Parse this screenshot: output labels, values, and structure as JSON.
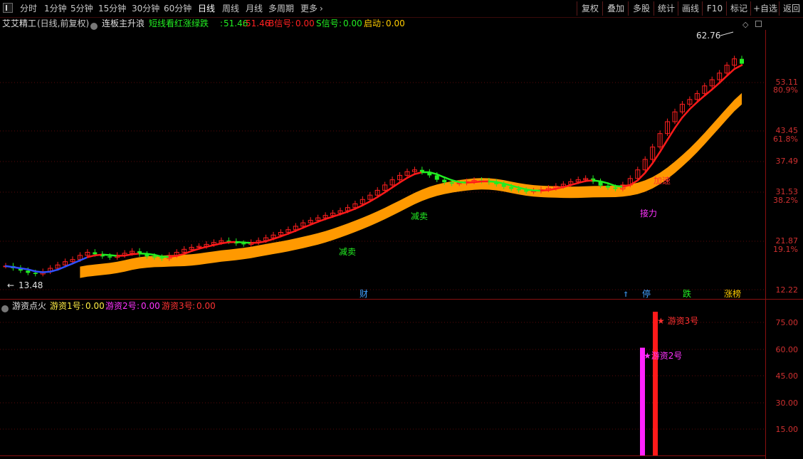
{
  "toolbar": {
    "period_tabs": [
      "分时",
      "1分钟",
      "5分钟",
      "15分钟",
      "30分钟",
      "60分钟",
      "日线",
      "周线",
      "月线",
      "多周期",
      "更多"
    ],
    "active_tab": "日线",
    "right_buttons": [
      "复权",
      "叠加",
      "多股",
      "统计",
      "画线",
      "F10",
      "标记",
      "+自选",
      "返回"
    ]
  },
  "main_header": {
    "stock_name": "艾艾精工",
    "mode": "(日线,前复权)",
    "indicator_name": "连板主升浪",
    "line_label": "短线看红涨绿跌",
    "line_value_1": "51.46",
    "line_value_2": "51.46",
    "b_signal_label": "B信号",
    "b_signal_value": "0.00",
    "s_signal_label": "S信号",
    "s_signal_value": "0.00",
    "start_label": "启动",
    "start_value": "0.00"
  },
  "price_axis": {
    "ticks": [
      "53.11",
      "43.45",
      "37.49",
      "31.53",
      "21.87",
      "12.22"
    ],
    "percent_ticks": [
      "80.9%",
      "61.8%",
      "38.2%",
      "19.1%"
    ]
  },
  "main_annotations": {
    "max_price": "62.76",
    "min_price": "13.48",
    "reduce_1": "减卖",
    "reduce_2": "减卖",
    "accelerate": "加速",
    "relay": "接力",
    "marker_cai": "财",
    "marker_ting": "停",
    "marker_die": "跌",
    "marker_zhangbang": "涨榜"
  },
  "sub_header": {
    "indicator_name": "游资点火",
    "y1_label": "游资1号",
    "y1_value": "0.00",
    "y2_label": "游资2号",
    "y2_value": "0.00",
    "y3_label": "游资3号",
    "y3_value": "0.00"
  },
  "sub_axis": {
    "ticks": [
      "75.00",
      "60.00",
      "45.00",
      "30.00",
      "15.00"
    ]
  },
  "sub_annotations": {
    "bar2_label": "★游资2号",
    "bar3_label": "★ 游资3号"
  },
  "chart_data": [
    {
      "type": "candlestick",
      "title": "艾艾精工 (日线,前复权)",
      "ylim": [
        12.22,
        63
      ],
      "series": [
        {
          "name": "短线看红涨绿跌",
          "color": "#ff2020",
          "last_value": 51.46
        },
        {
          "name": "band",
          "color": "#ff9900"
        }
      ],
      "candles_close_approx": [
        14.2,
        14.0,
        13.8,
        13.6,
        13.5,
        13.7,
        14.0,
        14.3,
        14.6,
        14.8,
        15.2,
        15.5,
        15.3,
        15.1,
        15.0,
        15.2,
        15.4,
        15.6,
        15.3,
        15.1,
        15.0,
        14.9,
        15.2,
        15.5,
        15.8,
        16.0,
        16.1,
        16.3,
        16.5,
        16.7,
        16.6,
        16.4,
        16.3,
        16.5,
        16.7,
        17.0,
        17.3,
        17.6,
        17.9,
        18.3,
        18.7,
        19.0,
        19.3,
        19.6,
        19.9,
        20.2,
        20.6,
        21.1,
        21.7,
        22.3,
        23.0,
        23.8,
        24.6,
        25.3,
        25.9,
        26.2,
        25.8,
        25.3,
        24.6,
        24.2,
        24.0,
        24.1,
        24.3,
        24.5,
        24.4,
        24.2,
        23.9,
        23.5,
        23.2,
        23.0,
        22.8,
        22.9,
        23.1,
        23.3,
        23.6,
        23.9,
        24.3,
        24.6,
        24.8,
        24.3,
        23.7,
        23.4,
        23.2,
        23.8,
        24.8,
        26.2,
        28.0,
        30.3,
        33.0,
        35.6,
        37.9,
        39.8,
        41.0,
        42.6,
        44.7,
        46.5,
        48.5,
        51.0,
        53.1,
        51.5
      ],
      "max_price": 62.76,
      "min_price": 13.48
    },
    {
      "type": "bar",
      "title": "游资点火",
      "ylim": [
        0,
        84
      ],
      "series": [
        {
          "name": "游资2号",
          "color": "#ff22ff",
          "values": [
            60
          ]
        },
        {
          "name": "游资3号",
          "color": "#ff1a1a",
          "values": [
            80
          ]
        }
      ]
    }
  ]
}
